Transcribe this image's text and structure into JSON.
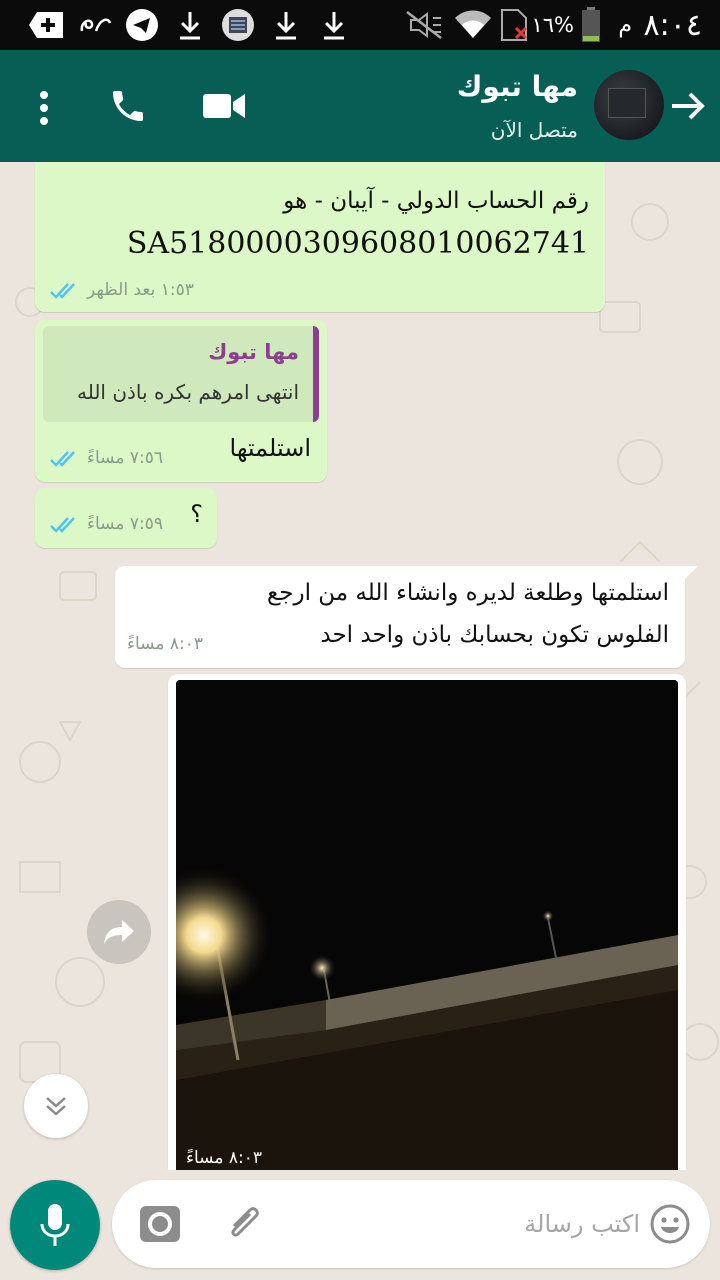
{
  "status_bar": {
    "time": "٨:٠٤",
    "ampm": "م",
    "battery_percent": "١٦%"
  },
  "header": {
    "contact_name": "مها تبوك",
    "contact_status": "متصل الآن",
    "icons": [
      "back-arrow-icon",
      "video-call-icon",
      "voice-call-icon",
      "more-options-icon"
    ]
  },
  "messages": [
    {
      "type": "outgoing",
      "line1": "رقم الحساب الدولي - آيبان - هو",
      "line2": "SA5180000309608010062741",
      "time": "١:٥٣ بعد الظهر",
      "status": "read"
    },
    {
      "type": "outgoing",
      "quote_author": "مها تبوك",
      "quote_text": "انتهى امرهم بكره باذن الله",
      "text": "استلمتها",
      "time": "٧:٥٦ مساءً",
      "status": "read"
    },
    {
      "type": "outgoing",
      "text": "؟",
      "time": "٧:٥٩ مساءً",
      "status": "read"
    },
    {
      "type": "incoming",
      "line1": "استلمتها وطلعة لديره وانشاء الله من ارجع",
      "line2": "الفلوس تكون بحسابك باذن واحد احد",
      "time": "٨:٠٣ مساءً"
    },
    {
      "type": "incoming-image",
      "time": "٨:٠٣ مساءً"
    }
  ],
  "composer": {
    "placeholder": "اكتب رسالة"
  },
  "colors": {
    "header": "#075e54",
    "outgoing_bubble": "#dcf8c6",
    "incoming_bubble": "#ffffff",
    "read_ticks": "#4fc3f7",
    "mic_button": "#00897b",
    "chat_background": "#ece5dd"
  }
}
